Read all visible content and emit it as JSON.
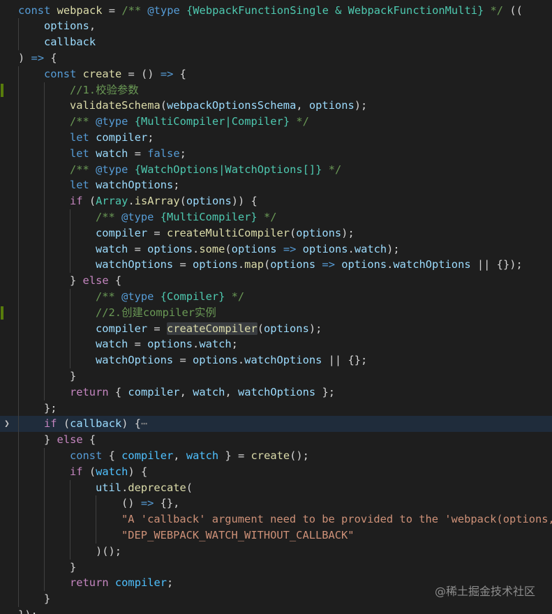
{
  "editor": {
    "lines": [
      {
        "indent": 0,
        "tokens": [
          [
            "kw",
            "const"
          ],
          [
            "op",
            " "
          ],
          [
            "fn",
            "webpack"
          ],
          [
            "op",
            " = "
          ],
          [
            "cm",
            "/** "
          ],
          [
            "kw",
            "@type"
          ],
          [
            "cm",
            " "
          ],
          [
            "type",
            "{WebpackFunctionSingle & WebpackFunctionMulti}"
          ],
          [
            "cm",
            " */"
          ],
          [
            "op",
            " (("
          ]
        ]
      },
      {
        "indent": 1,
        "tokens": [
          [
            "var",
            "options"
          ],
          [
            "op",
            ","
          ]
        ]
      },
      {
        "indent": 1,
        "tokens": [
          [
            "var",
            "callback"
          ]
        ]
      },
      {
        "indent": 0,
        "tokens": [
          [
            "op",
            ") "
          ],
          [
            "kw",
            "=>"
          ],
          [
            "op",
            " {"
          ]
        ]
      },
      {
        "indent": 1,
        "tokens": [
          [
            "kw",
            "const"
          ],
          [
            "op",
            " "
          ],
          [
            "fn",
            "create"
          ],
          [
            "op",
            " = () "
          ],
          [
            "kw",
            "=>"
          ],
          [
            "op",
            " {"
          ]
        ]
      },
      {
        "indent": 2,
        "modified": true,
        "tokens": [
          [
            "cm",
            "//1.校验参数"
          ]
        ]
      },
      {
        "indent": 2,
        "tokens": [
          [
            "fn",
            "validateSchema"
          ],
          [
            "op",
            "("
          ],
          [
            "var",
            "webpackOptionsSchema"
          ],
          [
            "op",
            ", "
          ],
          [
            "var",
            "options"
          ],
          [
            "op",
            ");"
          ]
        ]
      },
      {
        "indent": 2,
        "tokens": [
          [
            "cm",
            "/** "
          ],
          [
            "kw",
            "@type"
          ],
          [
            "cm",
            " "
          ],
          [
            "type",
            "{MultiCompiler|Compiler}"
          ],
          [
            "cm",
            " */"
          ]
        ]
      },
      {
        "indent": 2,
        "tokens": [
          [
            "kw",
            "let"
          ],
          [
            "op",
            " "
          ],
          [
            "var",
            "compiler"
          ],
          [
            "op",
            ";"
          ]
        ]
      },
      {
        "indent": 2,
        "tokens": [
          [
            "kw",
            "let"
          ],
          [
            "op",
            " "
          ],
          [
            "var",
            "watch"
          ],
          [
            "op",
            " = "
          ],
          [
            "kw",
            "false"
          ],
          [
            "op",
            ";"
          ]
        ]
      },
      {
        "indent": 2,
        "tokens": [
          [
            "cm",
            "/** "
          ],
          [
            "kw",
            "@type"
          ],
          [
            "cm",
            " "
          ],
          [
            "type",
            "{WatchOptions|WatchOptions[]}"
          ],
          [
            "cm",
            " */"
          ]
        ]
      },
      {
        "indent": 2,
        "tokens": [
          [
            "kw",
            "let"
          ],
          [
            "op",
            " "
          ],
          [
            "var",
            "watchOptions"
          ],
          [
            "op",
            ";"
          ]
        ]
      },
      {
        "indent": 2,
        "tokens": [
          [
            "ctrl",
            "if"
          ],
          [
            "op",
            " ("
          ],
          [
            "type",
            "Array"
          ],
          [
            "op",
            "."
          ],
          [
            "fn",
            "isArray"
          ],
          [
            "op",
            "("
          ],
          [
            "var",
            "options"
          ],
          [
            "op",
            ")) {"
          ]
        ]
      },
      {
        "indent": 3,
        "tokens": [
          [
            "cm",
            "/** "
          ],
          [
            "kw",
            "@type"
          ],
          [
            "cm",
            " "
          ],
          [
            "type",
            "{MultiCompiler}"
          ],
          [
            "cm",
            " */"
          ]
        ]
      },
      {
        "indent": 3,
        "tokens": [
          [
            "var",
            "compiler"
          ],
          [
            "op",
            " = "
          ],
          [
            "fn",
            "createMultiCompiler"
          ],
          [
            "op",
            "("
          ],
          [
            "var",
            "options"
          ],
          [
            "op",
            ");"
          ]
        ]
      },
      {
        "indent": 3,
        "tokens": [
          [
            "var",
            "watch"
          ],
          [
            "op",
            " = "
          ],
          [
            "var",
            "options"
          ],
          [
            "op",
            "."
          ],
          [
            "fn",
            "some"
          ],
          [
            "op",
            "("
          ],
          [
            "var",
            "options"
          ],
          [
            "op",
            " "
          ],
          [
            "kw",
            "=>"
          ],
          [
            "op",
            " "
          ],
          [
            "var",
            "options"
          ],
          [
            "op",
            "."
          ],
          [
            "var",
            "watch"
          ],
          [
            "op",
            ");"
          ]
        ]
      },
      {
        "indent": 3,
        "tokens": [
          [
            "var",
            "watchOptions"
          ],
          [
            "op",
            " = "
          ],
          [
            "var",
            "options"
          ],
          [
            "op",
            "."
          ],
          [
            "fn",
            "map"
          ],
          [
            "op",
            "("
          ],
          [
            "var",
            "options"
          ],
          [
            "op",
            " "
          ],
          [
            "kw",
            "=>"
          ],
          [
            "op",
            " "
          ],
          [
            "var",
            "options"
          ],
          [
            "op",
            "."
          ],
          [
            "var",
            "watchOptions"
          ],
          [
            "op",
            " || {});"
          ]
        ]
      },
      {
        "indent": 2,
        "tokens": [
          [
            "op",
            "} "
          ],
          [
            "ctrl",
            "else"
          ],
          [
            "op",
            " {"
          ]
        ]
      },
      {
        "indent": 3,
        "tokens": [
          [
            "cm",
            "/** "
          ],
          [
            "kw",
            "@type"
          ],
          [
            "cm",
            " "
          ],
          [
            "type",
            "{Compiler}"
          ],
          [
            "cm",
            " */"
          ]
        ]
      },
      {
        "indent": 3,
        "modified": true,
        "tokens": [
          [
            "cm",
            "//2.创建compiler实例"
          ]
        ]
      },
      {
        "indent": 3,
        "tokens": [
          [
            "var",
            "compiler"
          ],
          [
            "op",
            " = "
          ],
          [
            "fnhl",
            "createCompiler"
          ],
          [
            "op",
            "("
          ],
          [
            "var",
            "options"
          ],
          [
            "op",
            ");"
          ]
        ]
      },
      {
        "indent": 3,
        "tokens": [
          [
            "var",
            "watch"
          ],
          [
            "op",
            " = "
          ],
          [
            "var",
            "options"
          ],
          [
            "op",
            "."
          ],
          [
            "var",
            "watch"
          ],
          [
            "op",
            ";"
          ]
        ]
      },
      {
        "indent": 3,
        "tokens": [
          [
            "var",
            "watchOptions"
          ],
          [
            "op",
            " = "
          ],
          [
            "var",
            "options"
          ],
          [
            "op",
            "."
          ],
          [
            "var",
            "watchOptions"
          ],
          [
            "op",
            " || {};"
          ]
        ]
      },
      {
        "indent": 2,
        "tokens": [
          [
            "op",
            "}"
          ]
        ]
      },
      {
        "indent": 2,
        "tokens": [
          [
            "ctrl",
            "return"
          ],
          [
            "op",
            " { "
          ],
          [
            "var",
            "compiler"
          ],
          [
            "op",
            ", "
          ],
          [
            "var",
            "watch"
          ],
          [
            "op",
            ", "
          ],
          [
            "var",
            "watchOptions"
          ],
          [
            "op",
            " };"
          ]
        ]
      },
      {
        "indent": 1,
        "tokens": [
          [
            "op",
            "};"
          ]
        ]
      },
      {
        "indent": 1,
        "current": true,
        "folded": true,
        "tokens": [
          [
            "ctrl",
            "if"
          ],
          [
            "op",
            " ("
          ],
          [
            "var",
            "callback"
          ],
          [
            "op",
            ") {"
          ],
          [
            "dim",
            "⋯"
          ]
        ]
      },
      {
        "indent": 1,
        "tokens": [
          [
            "op",
            "} "
          ],
          [
            "ctrl",
            "else"
          ],
          [
            "op",
            " {"
          ]
        ]
      },
      {
        "indent": 2,
        "tokens": [
          [
            "kw",
            "const"
          ],
          [
            "op",
            " { "
          ],
          [
            "const",
            "compiler"
          ],
          [
            "op",
            ", "
          ],
          [
            "const",
            "watch"
          ],
          [
            "op",
            " } = "
          ],
          [
            "fn",
            "create"
          ],
          [
            "op",
            "();"
          ]
        ]
      },
      {
        "indent": 2,
        "tokens": [
          [
            "ctrl",
            "if"
          ],
          [
            "op",
            " ("
          ],
          [
            "const",
            "watch"
          ],
          [
            "op",
            ") {"
          ]
        ]
      },
      {
        "indent": 3,
        "tokens": [
          [
            "var",
            "util"
          ],
          [
            "op",
            "."
          ],
          [
            "fn",
            "deprecate"
          ],
          [
            "op",
            "("
          ]
        ]
      },
      {
        "indent": 4,
        "tokens": [
          [
            "op",
            "() "
          ],
          [
            "kw",
            "=>"
          ],
          [
            "op",
            " {},"
          ]
        ]
      },
      {
        "indent": 4,
        "tokens": [
          [
            "str",
            "\"A 'callback' argument need to be provided to the 'webpack(options, callback)' function\""
          ]
        ]
      },
      {
        "indent": 4,
        "tokens": [
          [
            "str",
            "\"DEP_WEBPACK_WATCH_WITHOUT_CALLBACK\""
          ]
        ]
      },
      {
        "indent": 3,
        "tokens": [
          [
            "op",
            ")();"
          ]
        ]
      },
      {
        "indent": 2,
        "tokens": [
          [
            "op",
            "}"
          ]
        ]
      },
      {
        "indent": 2,
        "tokens": [
          [
            "ctrl",
            "return"
          ],
          [
            "op",
            " "
          ],
          [
            "const",
            "compiler"
          ],
          [
            "op",
            ";"
          ]
        ]
      },
      {
        "indent": 1,
        "tokens": [
          [
            "op",
            "}"
          ]
        ]
      },
      {
        "indent": 0,
        "tokens": [
          [
            "op",
            "});"
          ]
        ]
      }
    ]
  },
  "watermark": {
    "text": "@稀土掘金技术社区"
  },
  "colors": {
    "background": "#1e1e1e",
    "keyword": "#569cd6",
    "control": "#c586c0",
    "function": "#dcdcaa",
    "variable": "#9cdcfe",
    "constant": "#4fc1ff",
    "type": "#4ec9b0",
    "string": "#ce9178",
    "comment": "#6a9955",
    "modified_gutter": "#587c0c"
  },
  "icons": {
    "fold_marker": "chevron-right-icon"
  }
}
